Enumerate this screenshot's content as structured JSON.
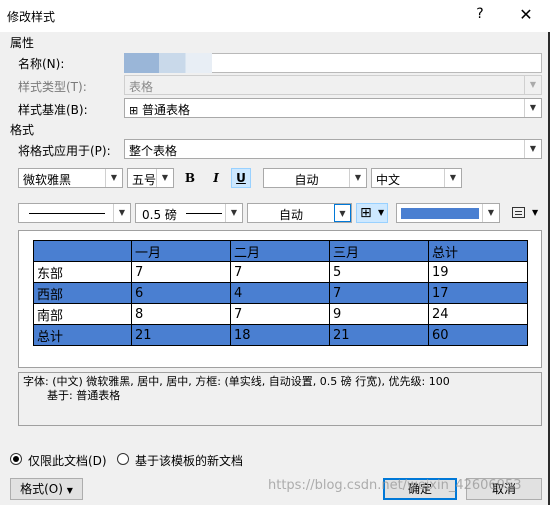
{
  "window": {
    "title": "修改样式",
    "help": "?",
    "close": "✕"
  },
  "properties": {
    "section": "属性",
    "name_label": "名称(N):",
    "name_value": "",
    "style_type_label": "样式类型(T):",
    "style_type_value": "表格",
    "style_base_label": "样式基准(B):",
    "style_base_value": "普通表格"
  },
  "format": {
    "section": "格式",
    "apply_to_label": "将格式应用于(P):",
    "apply_to_value": "整个表格",
    "font": "微软雅黑",
    "size": "五号",
    "bold": "B",
    "italic": "I",
    "underline": "U",
    "font_color": "自动",
    "script": "中文",
    "border_width": "0.5 磅",
    "border_color": "自动",
    "shading_color": "#4a7fd1"
  },
  "preview": {
    "rows": [
      [
        "",
        "一月",
        "二月",
        "三月",
        "总计"
      ],
      [
        "东部",
        "7",
        "7",
        "5",
        "19"
      ],
      [
        "西部",
        "6",
        "4",
        "7",
        "17"
      ],
      [
        "南部",
        "8",
        "7",
        "9",
        "24"
      ],
      [
        "总计",
        "21",
        "18",
        "21",
        "60"
      ]
    ]
  },
  "description": {
    "line1": "字体: (中文) 微软雅黑, 居中, 居中, 方框: (单实线, 自动设置,  0.5 磅 行宽), 优先级: 100",
    "line2": "基于: 普通表格"
  },
  "options": {
    "only_this_doc": "仅限此文档(D)",
    "template_docs": "基于该模板的新文档"
  },
  "buttons": {
    "format": "格式(O)",
    "ok": "确定",
    "cancel": "取消"
  },
  "watermark": "https://blog.csdn.net/weixin_42606953"
}
